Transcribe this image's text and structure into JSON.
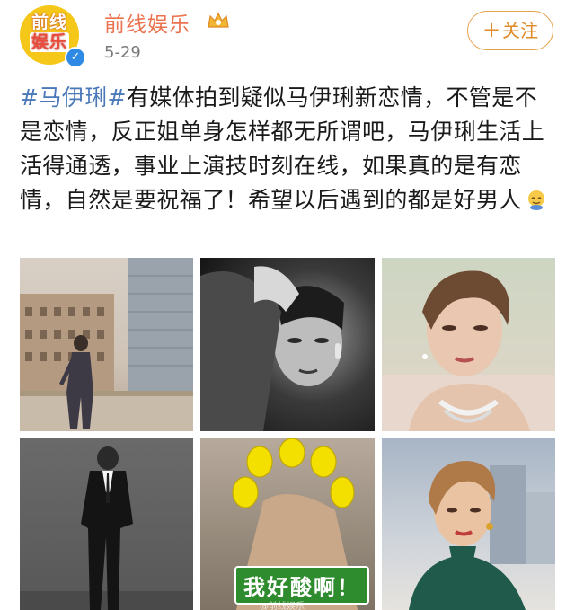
{
  "account": {
    "avatar_text_line1": "前线",
    "avatar_text_line2": "娱乐",
    "name": "前线娱乐",
    "date": "5-29",
    "follow_label": "关注",
    "follow_plus": "+"
  },
  "post": {
    "hashtag": "#马伊琍#",
    "body": "有媒体拍到疑似马伊琍新恋情，不管是不是恋情，反正姐单身怎样都无所谓吧，马伊琍生活上活得通透，事业上演技时刻在线，如果真的是有恋情，自然是要祝福了！希望以后遇到的都是好男人"
  },
  "images": [
    {
      "name": "photo-building-rooftop"
    },
    {
      "name": "photo-black-white-embrace"
    },
    {
      "name": "photo-short-hair-necklace"
    },
    {
      "name": "photo-black-suit"
    },
    {
      "name": "photo-lemon-meme",
      "caption": "我好酸啊！",
      "watermark": "@前线娱乐"
    },
    {
      "name": "photo-green-dress"
    }
  ],
  "icons": {
    "verified": "verified-badge-icon",
    "crown": "crown-icon",
    "emoji": "emoji-icon"
  },
  "colors": {
    "accent_name": "#eb7350",
    "hashtag": "#4a78b8",
    "follow_border": "#e5a14a",
    "verified": "#2f8ae5"
  }
}
